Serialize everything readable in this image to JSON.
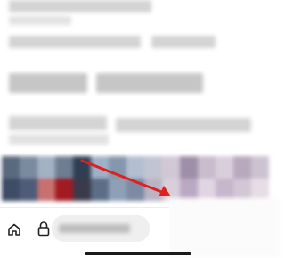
{
  "page": {
    "background": "#ffffff"
  },
  "annotation": {
    "arrow_color": "#e02020"
  },
  "toolbar": {
    "home_icon": "home-icon",
    "lock_icon": "lock-icon"
  },
  "mosaic_colors": [
    "#5a6a7e",
    "#7c8aa1",
    "#a3b1c5",
    "#6f7d93",
    "#2f3e52",
    "#9fb1c7",
    "#8597ad",
    "#b3bfd0",
    "#c2c5d1",
    "#d1c8d6",
    "#9e8ea8",
    "#c8bccd",
    "#d9cfdc",
    "#b9a9bf",
    "#cbc3d0",
    "#3e4c66",
    "#4e5c78",
    "#c86f6f",
    "#a21a22",
    "#3a3a4a",
    "#5b6e86",
    "#8e9fb6",
    "#7d8aa3",
    "#b9b3c3",
    "#d8cfd9",
    "#bba8c2",
    "#e0d5e0",
    "#c7b6cc",
    "#d3c6d6",
    "#e6dde7"
  ]
}
